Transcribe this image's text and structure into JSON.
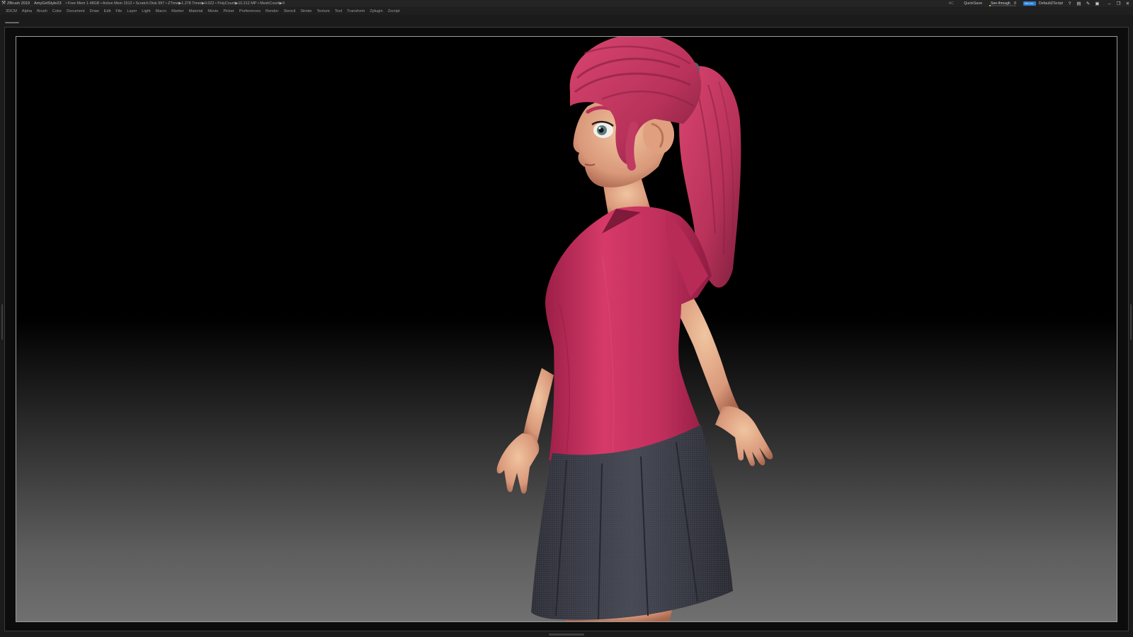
{
  "titlebar": {
    "app_name": "ZBrush 2019",
    "document": "AmyGirlStyle23",
    "stats": "• Free Mem 1.48GB • Active Mem 1512 • Scratch Disk 997 • ZTime▶1.278 Timer▶0.022 • PolyCount▶10.212 MP • MeshCount▶9",
    "ac": "AC",
    "quicksave": "QuickSave",
    "see_through_label": "See-through",
    "see_through_value": "0",
    "see_through_level": 0,
    "menus_label": "Menus",
    "script": "DefaultZScript"
  },
  "menubar": {
    "items": [
      "3DCM",
      "Alpha",
      "Brush",
      "Color",
      "Document",
      "Draw",
      "Edit",
      "File",
      "Layer",
      "Light",
      "Macro",
      "Marker",
      "Material",
      "Movie",
      "Picker",
      "Preferences",
      "Render",
      "Stencil",
      "Stroke",
      "Texture",
      "Tool",
      "Transform",
      "Zplugin",
      "Zscript"
    ]
  },
  "colors": {
    "accent": "#2f7fd6",
    "see_through_fill": "#d9a43a",
    "shirt": "#c2305c",
    "hair": "#c23a60",
    "skin": "#e0a481",
    "skirt": "#3d3e47"
  },
  "icons": [
    "app-icon",
    "help-icon",
    "layout-icon",
    "brush-icon",
    "lock-icon",
    "minimize-icon",
    "restore-icon",
    "close-icon"
  ]
}
